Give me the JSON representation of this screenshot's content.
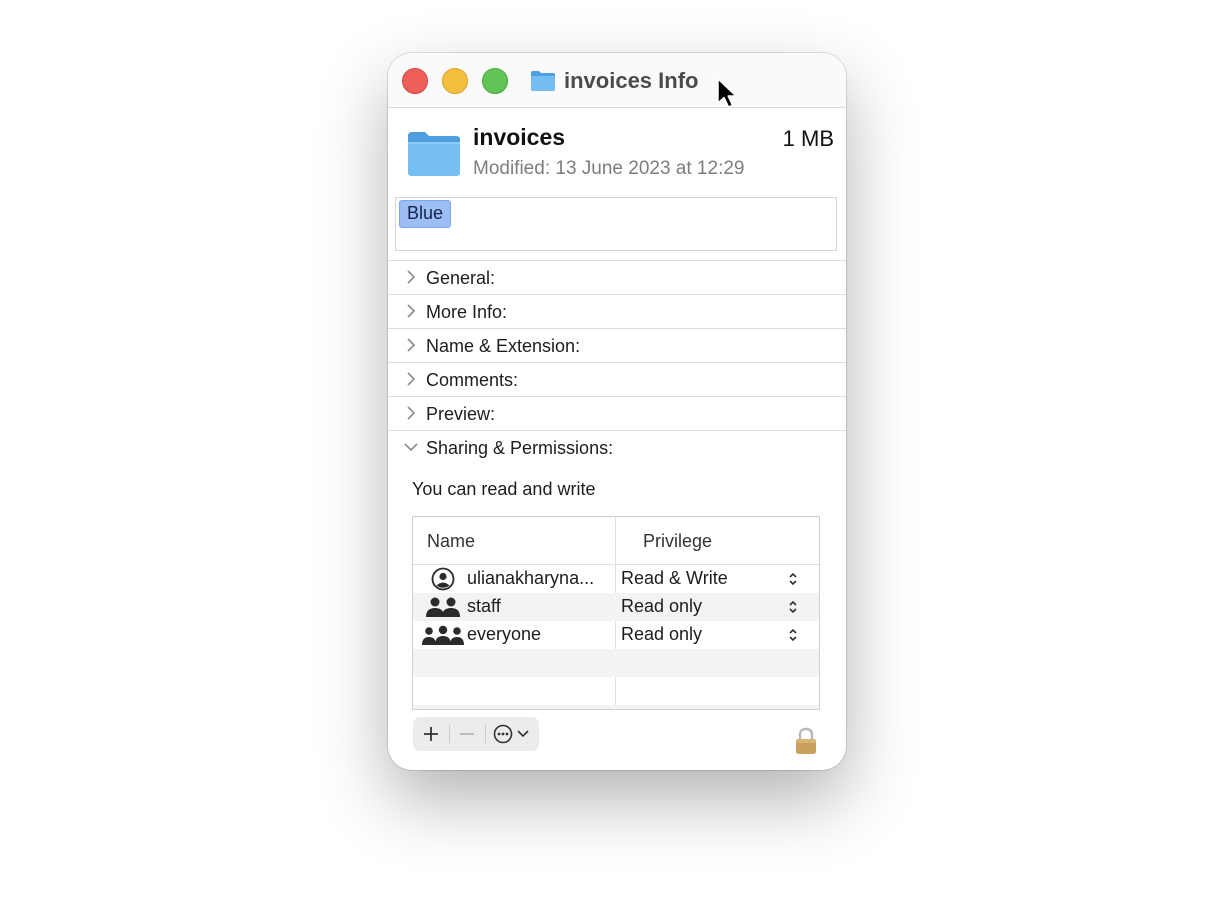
{
  "window": {
    "title": "invoices Info"
  },
  "file": {
    "name": "invoices",
    "size": "1 MB",
    "modified": "Modified: 13 June 2023 at 12:29"
  },
  "tags": [
    "Blue"
  ],
  "sections": [
    {
      "label": "General:",
      "expanded": false
    },
    {
      "label": "More Info:",
      "expanded": false
    },
    {
      "label": "Name & Extension:",
      "expanded": false
    },
    {
      "label": "Comments:",
      "expanded": false
    },
    {
      "label": "Preview:",
      "expanded": false
    },
    {
      "label": "Sharing & Permissions:",
      "expanded": true
    }
  ],
  "permissions": {
    "summary": "You can read and write",
    "columns": {
      "name": "Name",
      "privilege": "Privilege"
    },
    "rows": [
      {
        "name": "ulianakharyna...",
        "privilege": "Read & Write",
        "icon": "user-icon"
      },
      {
        "name": "staff",
        "privilege": "Read only",
        "icon": "group-icon"
      },
      {
        "name": "everyone",
        "privilege": "Read only",
        "icon": "everyone-icon"
      }
    ]
  },
  "toolbar": {
    "add_icon": "plus-icon",
    "remove_icon": "minus-icon",
    "action_icon": "ellipsis-circle-icon"
  },
  "colors": {
    "close": "#ec5f5a",
    "minimize": "#f4bf3d",
    "maximize": "#5fc454",
    "folder": "#5aaeea",
    "tag_blue": "#9dbdf5",
    "lock": "#c8a25c"
  }
}
